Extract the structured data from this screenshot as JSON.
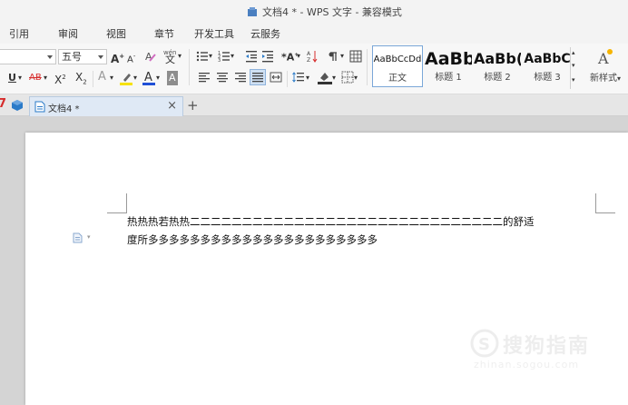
{
  "window": {
    "title": "文档4 * - WPS 文字 - 兼容模式"
  },
  "menu": [
    "引用",
    "审阅",
    "视图",
    "章节",
    "开发工具",
    "云服务"
  ],
  "toolbar": {
    "font_size": "五号",
    "wen_label": "wén",
    "wen_char": "文",
    "styles": [
      {
        "preview": "AaBbCcDd",
        "label": "正文"
      },
      {
        "preview": "AaBb",
        "label": "标题 1"
      },
      {
        "preview": "AaBb(",
        "label": "标题 2"
      },
      {
        "preview": "AaBbC",
        "label": "标题 3"
      }
    ],
    "new_style_label": "新样式",
    "new_style_icon_text": "A"
  },
  "tabs": {
    "doc_tab_label": "文档4 *",
    "close": "×",
    "add": "+"
  },
  "document": {
    "lines": [
      "热热热若热热二二二二二二二二二二二二二二二二二二二二二二二二二二二二二二的舒适",
      "度所多多多多多多多多多多多多多多多多多多多多多多"
    ]
  },
  "watermark": {
    "text": "搜狗指南",
    "url": "zhinan.sogou.com"
  },
  "colors": {
    "accent": "#2a7ac8",
    "highlight": "#f6e100",
    "font_color": "#1f4fd6",
    "red": "#d62c2c"
  }
}
